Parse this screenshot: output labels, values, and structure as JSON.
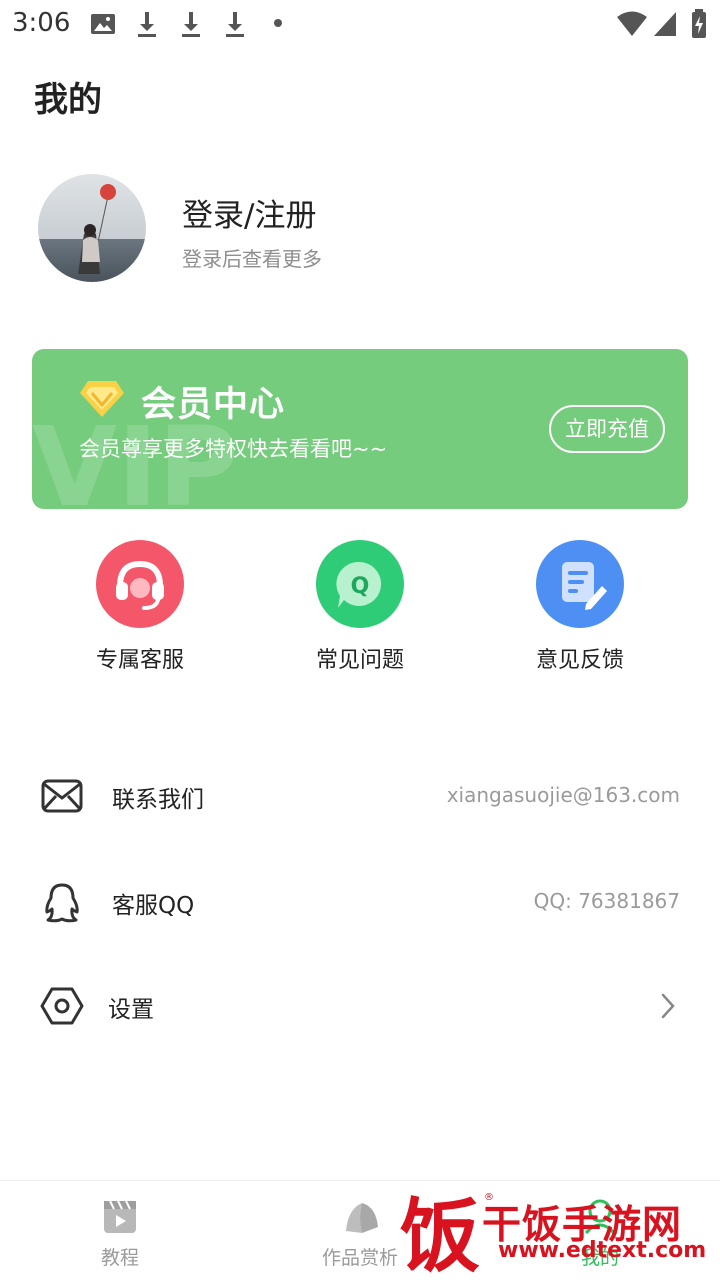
{
  "status_bar": {
    "time": "3:06"
  },
  "page": {
    "title": "我的"
  },
  "profile": {
    "title": "登录/注册",
    "subtitle": "登录后查看更多"
  },
  "vip": {
    "title": "会员中心",
    "desc": "会员尊享更多特权快去看看吧~~",
    "button": "立即充值",
    "watermark": "VIP",
    "color": "#74cc7c"
  },
  "quick_entries": [
    {
      "label": "专属客服",
      "icon": "headset-icon",
      "color": "#f4566a"
    },
    {
      "label": "常见问题",
      "icon": "question-bubble-icon",
      "color": "#2fcc78"
    },
    {
      "label": "意见反馈",
      "icon": "note-pencil-icon",
      "color": "#4d8ff2"
    }
  ],
  "list": [
    {
      "label": "联系我们",
      "value": "xiangasuojie@163.com",
      "icon": "mail-icon"
    },
    {
      "label": "客服QQ",
      "value": "QQ: 76381867",
      "icon": "qq-icon"
    },
    {
      "label": "设置",
      "icon": "settings-hexagon-icon"
    }
  ],
  "bottom_nav": [
    {
      "label": "教程",
      "icon": "video-clapper-icon"
    },
    {
      "label": "作品赏析",
      "icon": "book-icon"
    },
    {
      "label": "我的",
      "icon": "user-icon",
      "active": true
    }
  ],
  "watermark": {
    "big": "干饭手游网",
    "url": "www.edtext.com",
    "char": "饭",
    "reg": "®"
  }
}
